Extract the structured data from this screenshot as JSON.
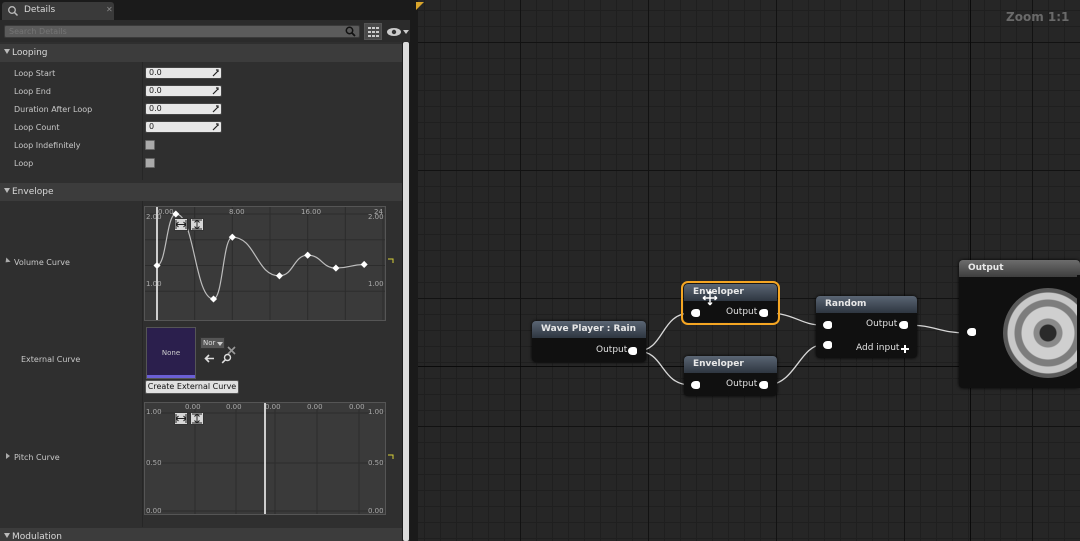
{
  "details": {
    "tab_title": "Details",
    "search_placeholder": "Search Details",
    "categories": {
      "looping": "Looping",
      "envelope": "Envelope",
      "modulation": "Modulation"
    },
    "looping": {
      "loop_start": {
        "label": "Loop Start",
        "value": "0.0"
      },
      "loop_end": {
        "label": "Loop End",
        "value": "0.0"
      },
      "duration_after_loop": {
        "label": "Duration After Loop",
        "value": "0.0"
      },
      "loop_count": {
        "label": "Loop Count",
        "value": "0"
      },
      "loop_indefinitely": {
        "label": "Loop Indefinitely",
        "checked": false
      },
      "loop": {
        "label": "Loop",
        "checked": false
      }
    },
    "envelope": {
      "volume_curve": {
        "label": "Volume Curve",
        "top_ticks": [
          "0.00",
          "8.00",
          "16.00",
          "24"
        ],
        "left_top": "2.00",
        "left_mid": "1.00",
        "right_top": "2.00",
        "right_mid": "1.00",
        "keys": [
          [
            0,
            1.0
          ],
          [
            2,
            2.0
          ],
          [
            6,
            0.35
          ],
          [
            8,
            1.55
          ],
          [
            13,
            0.8
          ],
          [
            16,
            1.2
          ],
          [
            19,
            0.95
          ],
          [
            22,
            1.02
          ]
        ]
      },
      "external_curve": {
        "label": "External Curve",
        "asset": "None",
        "combo": "Nor",
        "create_button": "Create External Curve"
      },
      "pitch_curve": {
        "label": "Pitch Curve",
        "top_ticks": [
          "0.00",
          "0.00",
          "0.00",
          "0.00",
          "0.00"
        ],
        "left_top": "1.00",
        "left_mid": "0.50",
        "left_bottom": "0.00",
        "right_top": "1.00",
        "right_mid": "0.50",
        "right_bottom": "0.00"
      }
    }
  },
  "graph": {
    "zoom": "Zoom 1:1",
    "nodes": {
      "wave_player": {
        "title": "Wave Player : Rain",
        "output": "Output"
      },
      "enveloper1": {
        "title": "Enveloper",
        "output": "Output"
      },
      "enveloper2": {
        "title": "Enveloper",
        "output": "Output"
      },
      "random": {
        "title": "Random",
        "output": "Output",
        "add_input": "Add input"
      },
      "output": {
        "title": "Output"
      }
    }
  },
  "colors": {
    "selection": "#f5a623",
    "panel": "#2f2f2f",
    "graph_bg": "#262626",
    "accent_yellow": "#d9a52b"
  }
}
